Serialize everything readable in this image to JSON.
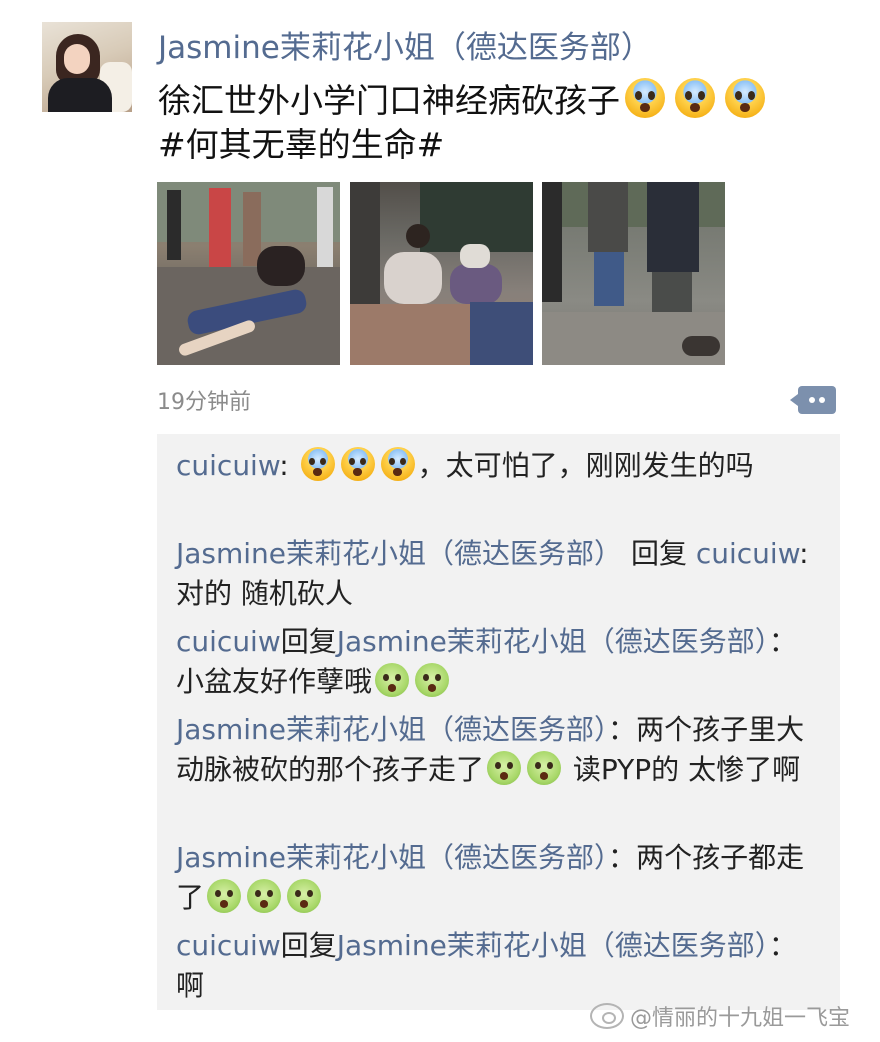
{
  "post": {
    "username": "Jasmine茉莉花小姐（德达医务部）",
    "text_line1": "徐汇世外小学门口神经病砍孩子",
    "text_line2": "#何其无辜的生命#",
    "time": "19分钟前",
    "emoji_icons": [
      "scream-face-icon",
      "scream-face-icon",
      "scream-face-icon"
    ]
  },
  "comments": [
    {
      "author": "cuicuiw",
      "sep": ": ",
      "text": "，太可怕了，刚刚发生的吗",
      "emoji": [
        "scream-face-icon",
        "scream-face-icon",
        "scream-face-icon"
      ]
    },
    {
      "author": "Jasmine茉莉花小姐（德达医务部）",
      "reply_word": " 回复 ",
      "target": "cuicuiw",
      "sep": ": ",
      "text": "对的 随机砍人"
    },
    {
      "author": "cuicuiw",
      "reply_word": "回复",
      "target": "Jasmine茉莉花小姐（德达医务部）",
      "sep": "：",
      "text": "小盆友好作孽哦",
      "emoji": [
        "nauseated-face-icon",
        "nauseated-face-icon"
      ]
    },
    {
      "author": "Jasmine茉莉花小姐（德达医务部）",
      "sep": "：",
      "text_a": "两个孩子里大动脉被砍的那个孩子走了",
      "text_b": " 读PYP的 太惨了啊",
      "emoji": [
        "nauseated-face-icon",
        "nauseated-face-icon"
      ]
    },
    {
      "author": "Jasmine茉莉花小姐（德达医务部）",
      "sep": "：",
      "text": "两个孩子都走了",
      "emoji": [
        "nauseated-face-icon",
        "nauseated-face-icon",
        "nauseated-face-icon"
      ]
    },
    {
      "author": "cuicuiw",
      "reply_word": "回复",
      "target": "Jasmine茉莉花小姐（德达医务部）",
      "sep": "：",
      "text": "啊"
    }
  ],
  "watermark": "@情丽的十九姐一飞宝",
  "colors": {
    "name": "#546b90",
    "time": "#8b8b8b",
    "comment_bg": "#f2f2f2"
  }
}
